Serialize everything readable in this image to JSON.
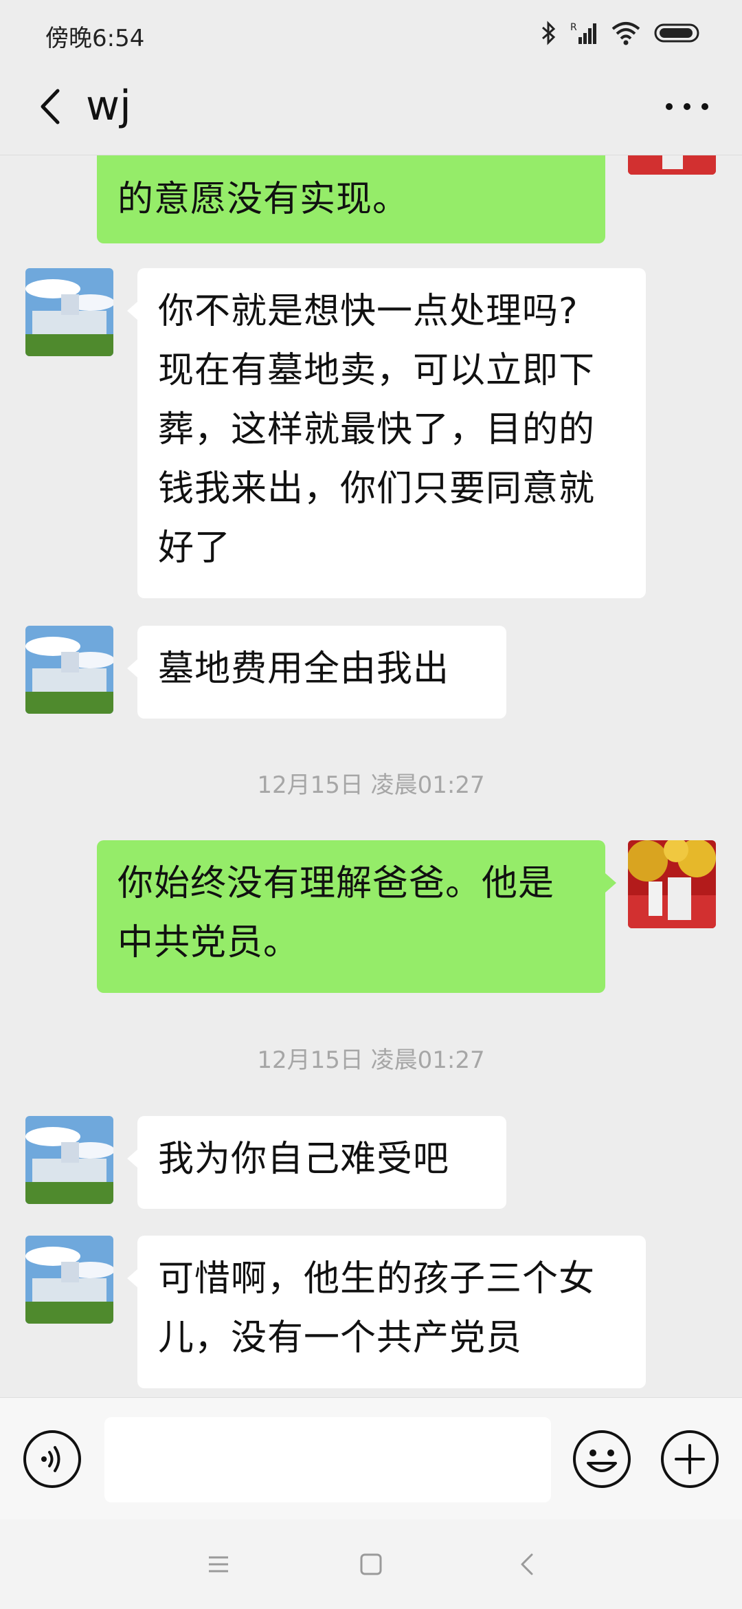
{
  "status_bar": {
    "time": "傍晚6:54",
    "icons": [
      "bluetooth-icon",
      "signal-icon",
      "wifi-icon",
      "battery-icon"
    ]
  },
  "header": {
    "title": "wj",
    "back_icon": "chevron-left-icon",
    "more_icon": "ellipsis-icon"
  },
  "messages": [
    {
      "side": "right",
      "text_lines": [
        "的意愿没有实现。"
      ]
    },
    {
      "side": "left",
      "text_lines": [
        "你不就是想快一点处理吗?",
        "现在有墓地卖，可以立即下",
        "葬，这样就最快了，目的的",
        "钱我来出，你们只要同意就",
        "好了"
      ]
    },
    {
      "side": "left",
      "text_lines": [
        "墓地费用全由我出"
      ]
    },
    {
      "timestamp": "12月15日 凌晨01:27"
    },
    {
      "side": "right",
      "text_lines": [
        "你始终没有理解爸爸。他是",
        "中共党员。"
      ]
    },
    {
      "timestamp": "12月15日 凌晨01:27"
    },
    {
      "side": "left",
      "text_lines": [
        "我为你自己难受吧"
      ]
    },
    {
      "side": "left",
      "text_lines": [
        "可惜啊，他生的孩子三个女",
        "儿，没有一个共产党员"
      ]
    }
  ],
  "input_bar": {
    "voice_icon": "voice-icon",
    "text_value": "",
    "emoji_icon": "emoji-icon",
    "plus_icon": "plus-icon"
  },
  "nav_bar": {
    "icons": [
      "menu-icon",
      "home-icon",
      "back-icon"
    ]
  },
  "colors": {
    "background": "#ededed",
    "outgoing_bubble": "#95ec69",
    "incoming_bubble": "#ffffff",
    "timestamp_text": "#a6a6a6"
  }
}
